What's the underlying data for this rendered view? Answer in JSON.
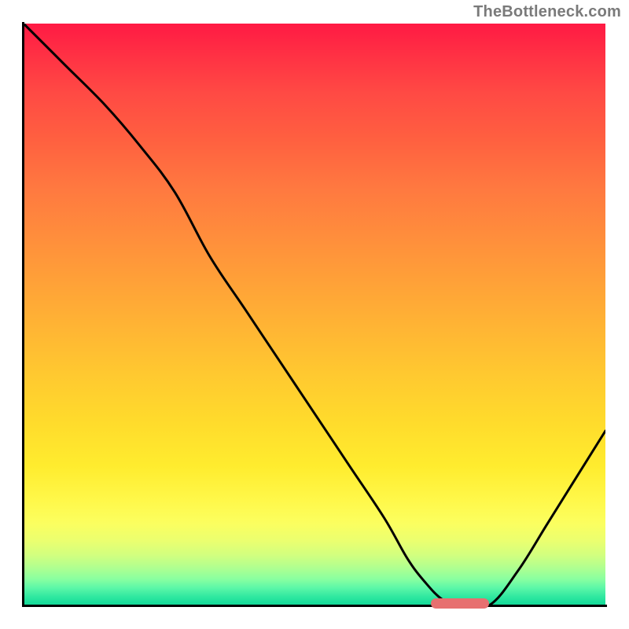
{
  "watermark": "TheBottleneck.com",
  "chart_data": {
    "type": "line",
    "title": "",
    "xlabel": "",
    "ylabel": "",
    "xlim": [
      0,
      100
    ],
    "ylim": [
      0,
      100
    ],
    "x": [
      0,
      7,
      14,
      20,
      26,
      32,
      38,
      44,
      50,
      56,
      62,
      66,
      69,
      72,
      75,
      80,
      85,
      90,
      95,
      100
    ],
    "values": [
      100,
      93,
      86,
      79,
      71,
      60,
      51,
      42,
      33,
      24,
      15,
      8,
      4,
      1,
      0,
      0,
      6,
      14,
      22,
      30
    ],
    "marker": {
      "x_start": 70,
      "x_end": 80,
      "y": 0
    },
    "gradient_note": "vertical background gradient from red (high) through orange/yellow to green (low)"
  },
  "colors": {
    "axis": "#000000",
    "curve": "#000000",
    "marker": "#e77070",
    "watermark": "#7a7a7a"
  }
}
